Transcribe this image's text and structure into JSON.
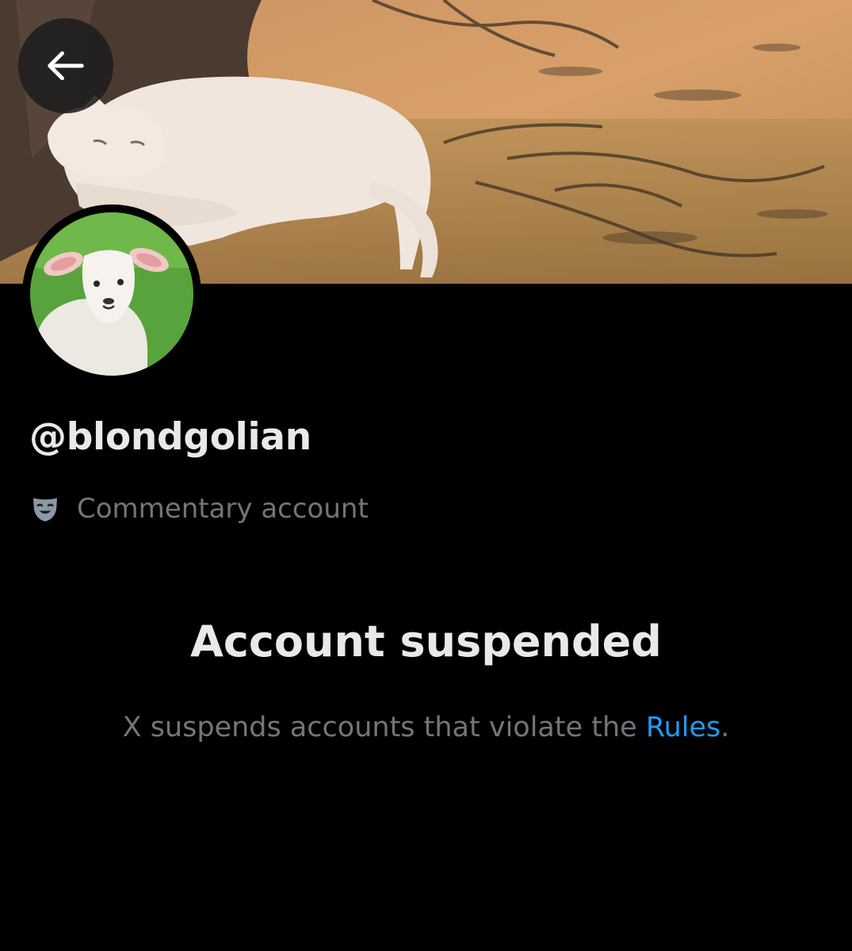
{
  "header": {
    "back_icon": "arrow-left-icon"
  },
  "profile": {
    "handle": "@blondgolian",
    "label_icon": "theater-mask-icon",
    "label": "Commentary account"
  },
  "notice": {
    "title": "Account suspended",
    "text_before_link": "X suspends accounts that violate the ",
    "link_text": "Rules",
    "text_after_link": "."
  },
  "colors": {
    "background": "#000000",
    "primary_text": "#e7e9ea",
    "secondary_text": "#71767b",
    "link": "#1d9bf0"
  }
}
